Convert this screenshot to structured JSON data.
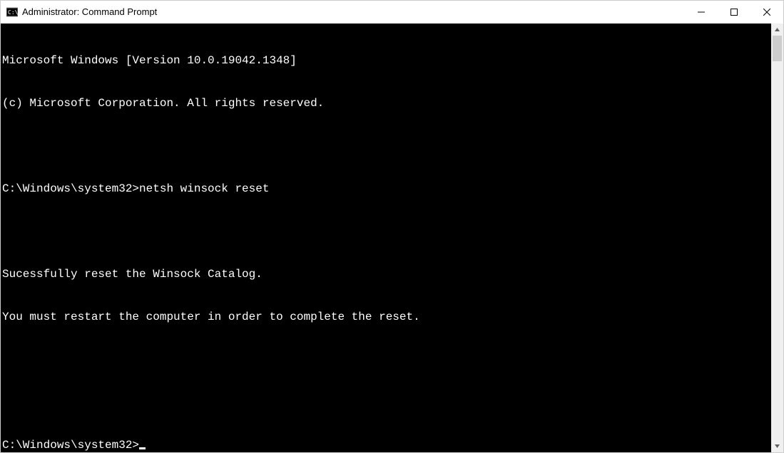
{
  "titlebar": {
    "title": "Administrator: Command Prompt"
  },
  "terminal": {
    "version_line": "Microsoft Windows [Version 10.0.19042.1348]",
    "copyright_line": "(c) Microsoft Corporation. All rights reserved.",
    "prompt1": "C:\\Windows\\system32>",
    "command1": "netsh winsock reset",
    "output1": "Sucessfully reset the Winsock Catalog.",
    "output2": "You must restart the computer in order to complete the reset.",
    "prompt2": "C:\\Windows\\system32>"
  }
}
